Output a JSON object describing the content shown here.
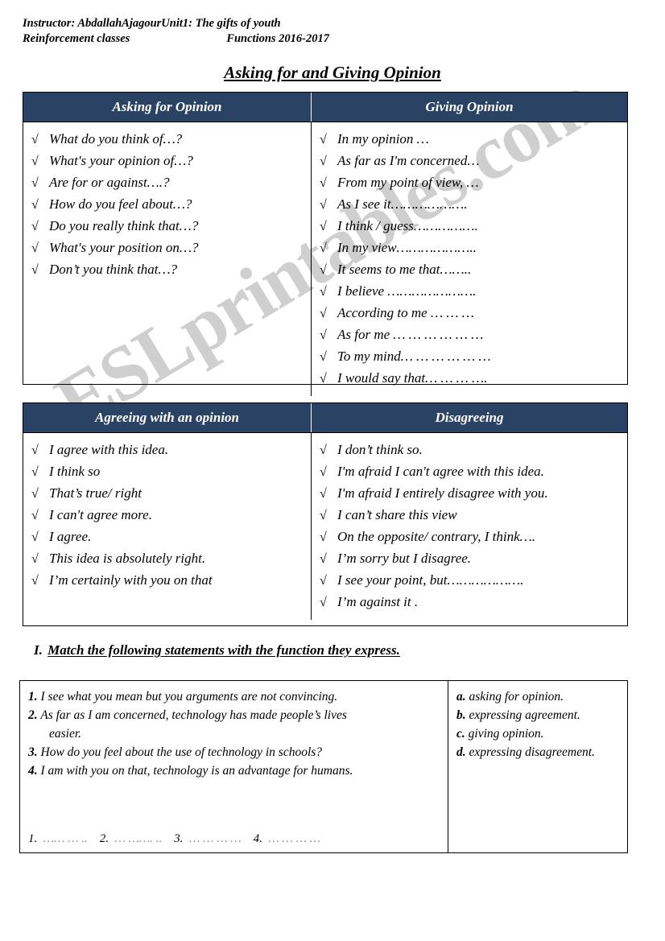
{
  "watermark": {
    "text": "ESLprintables.com",
    "color": "#cfcfcf"
  },
  "header": {
    "line1": "Instructor: AbdallahAjagourUnit1: The gifts of youth",
    "line2_left": "Reinforcement classes",
    "line2_right": "Functions 2016-2017"
  },
  "title": "Asking for and Giving Opinion",
  "theme": {
    "header_bar": "#2a4263",
    "header_text": "#ffffff",
    "border": "#000000"
  },
  "tick_glyph": "√",
  "table1": {
    "headers": {
      "left": "Asking for Opinion",
      "right": "Giving Opinion"
    },
    "left_items": [
      "What do you think of…?",
      "What's your opinion of…?",
      "Are for or against….?",
      "How do you feel about…?",
      "Do you really think that…?",
      "What's your position on…?",
      "Don’t you think that…?"
    ],
    "right_items": [
      "In my opinion …",
      "As far as I'm concerned…",
      "From my point of view, …",
      "As I see it……………….",
      "I think / guess…………….",
      "In my view………………..",
      "It seems to me that……..",
      "I believe ………………….",
      "According to me  … … …",
      "As for me … … … … … …",
      "To my mind… … … … … …",
      "I would say that… … … …."
    ]
  },
  "table2": {
    "headers": {
      "left": "Agreeing with an opinion",
      "right": "Disagreeing"
    },
    "left_items": [
      "I agree with this idea.",
      "I think so",
      "That’s true/ right",
      "I can't agree more.",
      "I agree.",
      "This idea is absolutely right.",
      "I’m certainly with you on that"
    ],
    "right_items": [
      "I don’t think so.",
      "I'm afraid I can't agree with this idea.",
      "I'm afraid I entirely disagree with you.",
      "I can’t share this view",
      "On the opposite/ contrary, I think….",
      "I’m sorry but I disagree.",
      "I see your point, but……………….",
      "I’m against it ."
    ]
  },
  "exercise": {
    "number": "I.",
    "instruction": "Match the following statements with the function they express.",
    "statements": [
      {
        "label": "1.",
        "text": "I see what you mean but you arguments are not convincing.",
        "cont": ""
      },
      {
        "label": "2.",
        "text": "As far as I am concerned, technology has made people’s lives",
        "cont": "easier."
      },
      {
        "label": "3.",
        "text": "How do you feel about the use of technology in schools?",
        "cont": ""
      },
      {
        "label": "4.",
        "text": "I am with you on that, technology is an advantage for humans.",
        "cont": ""
      }
    ],
    "functions": [
      {
        "label": "a.",
        "text": "asking for opinion."
      },
      {
        "label": "b.",
        "text": "expressing agreement."
      },
      {
        "label": "c.",
        "text": "giving opinion."
      },
      {
        "label": "d.",
        "text": "expressing disagreement."
      }
    ],
    "answer_slots": [
      {
        "num": "1.",
        "dots": "…… … .."
      },
      {
        "num": "2.",
        "dots": "… ……. .."
      },
      {
        "num": "3.",
        "dots": "… … … …"
      },
      {
        "num": "4.",
        "dots": "… … … …"
      }
    ]
  }
}
